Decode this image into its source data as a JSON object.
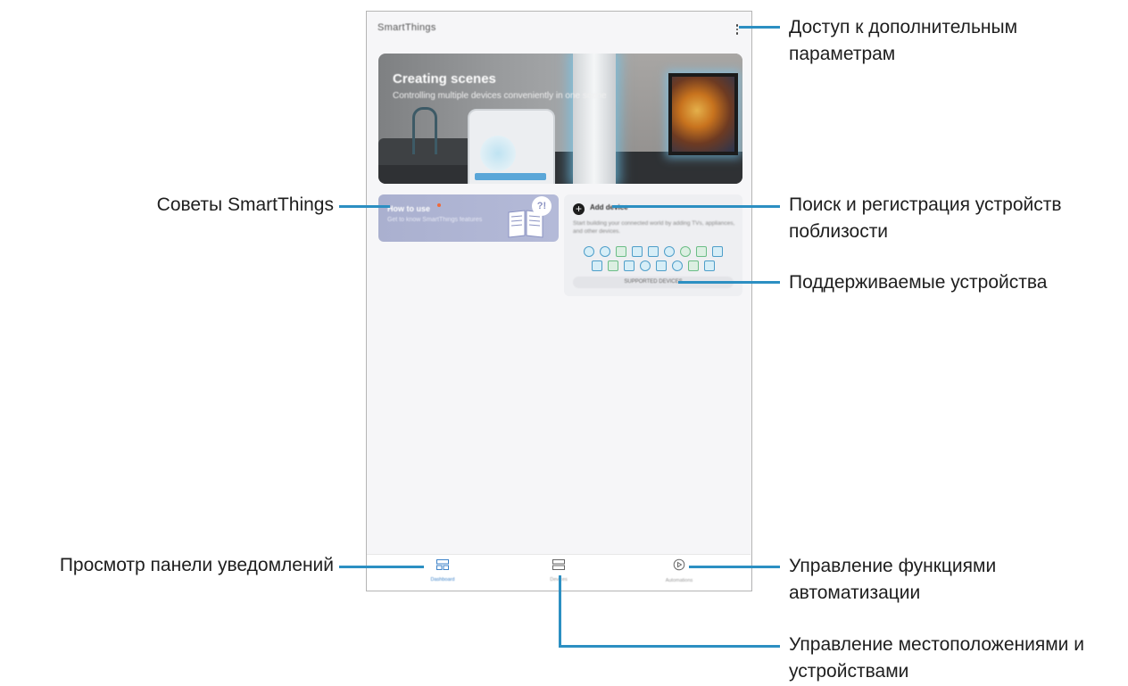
{
  "app": {
    "title": "SmartThings",
    "more_icon": "more-vertical-icon"
  },
  "hero": {
    "title": "Creating scenes",
    "subtitle": "Controlling multiple devices conveniently in one scene"
  },
  "tips_card": {
    "title": "How to use",
    "subtitle": "Get to know SmartThings features"
  },
  "add_device_card": {
    "label": "Add device",
    "description": "Start building your connected world by adding TVs, appliances, and other devices.",
    "supported_button": "SUPPORTED DEVICES"
  },
  "bottom_nav": {
    "items": [
      {
        "label": "Dashboard",
        "icon": "dashboard-icon",
        "active": true
      },
      {
        "label": "Devices",
        "icon": "devices-icon",
        "active": false
      },
      {
        "label": "Automations",
        "icon": "automations-icon",
        "active": false
      }
    ]
  },
  "annotations": {
    "more_options": "Доступ к дополнительным параметрам",
    "tips": "Советы SmartThings",
    "add_device": "Поиск и регистрация устройств поблизости",
    "supported_devices": "Поддерживаемые устройства",
    "dashboard": "Просмотр панели уведомлений",
    "automations": "Управление функциями автоматизации",
    "locations": "Управление местоположениями и устройствами"
  },
  "colors": {
    "leader_line": "#2c8fc2",
    "active_tab": "#3c82c8"
  }
}
